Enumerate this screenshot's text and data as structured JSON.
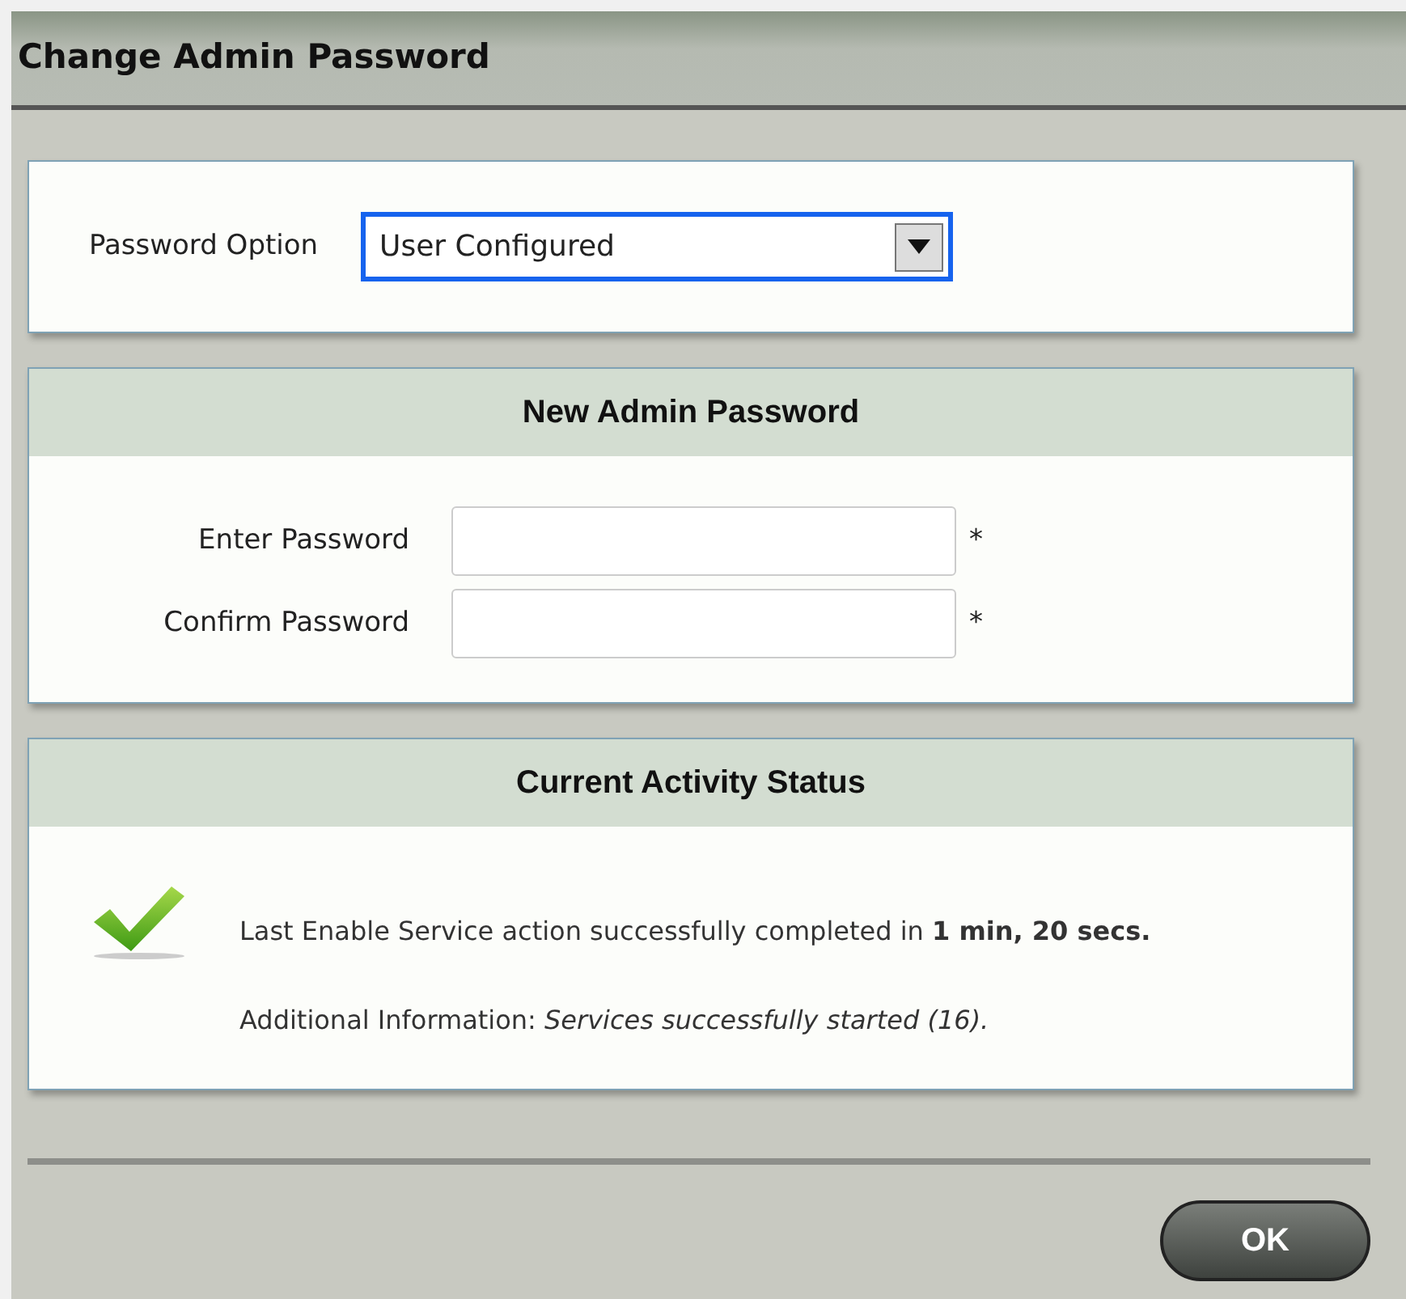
{
  "window": {
    "title": "Change Admin Password"
  },
  "password_option": {
    "label": "Password Option",
    "value": "User Configured",
    "focused": true
  },
  "new_password": {
    "title": "New Admin Password",
    "fields": [
      {
        "label": "Enter Password",
        "required_mark": "*"
      },
      {
        "label": "Confirm Password",
        "required_mark": "*"
      }
    ]
  },
  "activity_status": {
    "title": "Current Activity Status",
    "kind": "success",
    "message": "Last Enable Service action successfully completed in **1 min, 20 secs.**",
    "details": "Additional Information: *Services successfully started (16).*"
  },
  "buttons": [
    "OK"
  ]
}
